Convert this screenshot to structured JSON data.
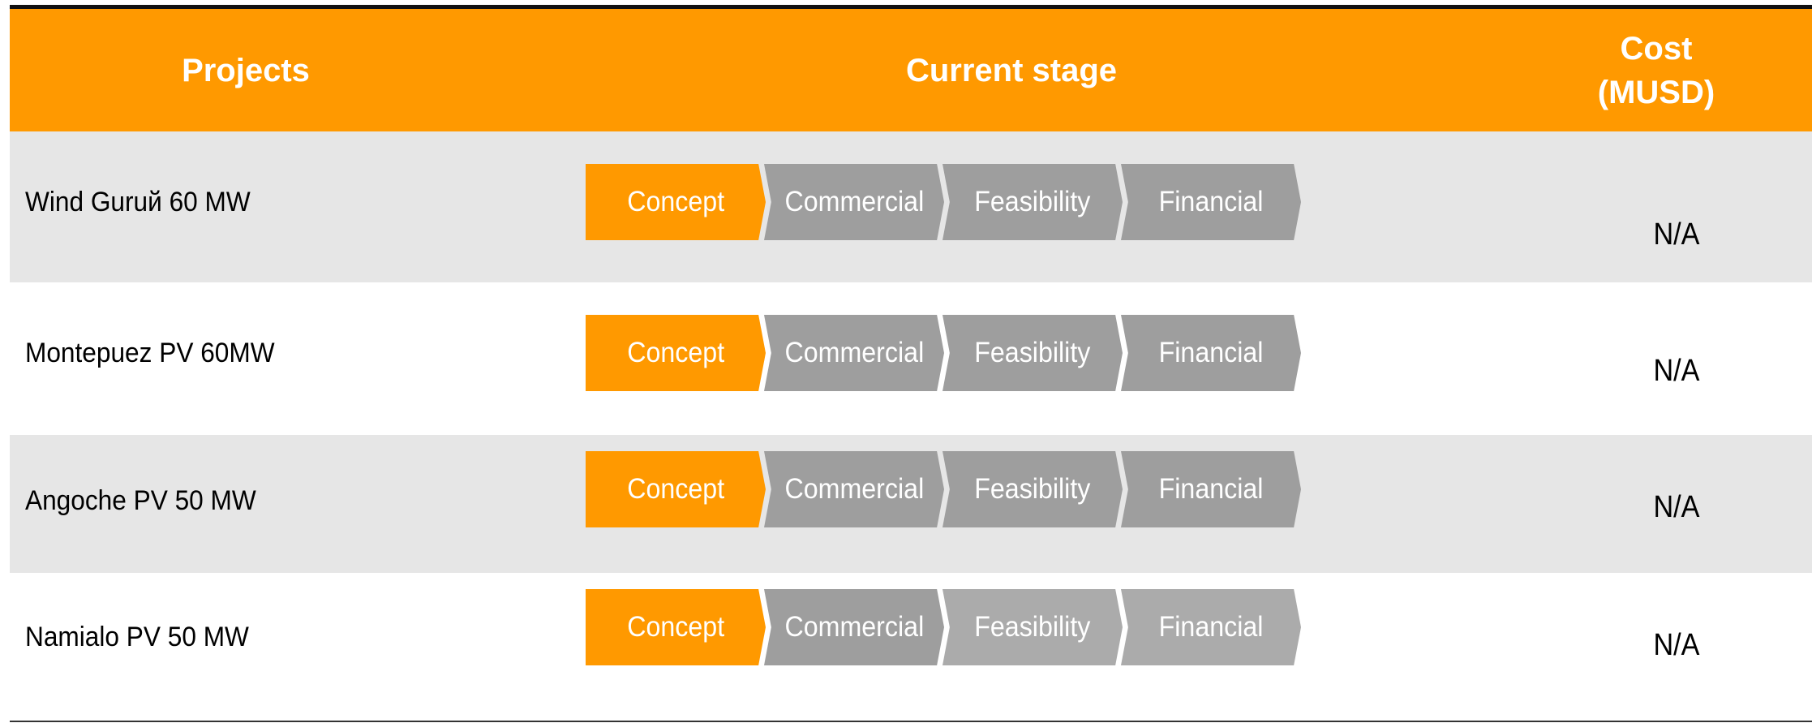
{
  "header": {
    "projects": "Projects",
    "current_stage": "Current stage",
    "cost": "Cost\n(MUSD)"
  },
  "stage_labels": [
    "Concept",
    "Commercial",
    "Feasibility",
    "Financial"
  ],
  "rows": [
    {
      "project": "Wind Guruй 60 MW",
      "cost": "N/A",
      "current_stage": "Concept"
    },
    {
      "project": "Montepuez PV 60MW",
      "cost": "N/A",
      "current_stage": "Concept"
    },
    {
      "project": "Angoche PV 50 MW",
      "cost": "N/A",
      "current_stage": "Concept"
    },
    {
      "project": "Namialo PV 50 MW",
      "cost": "N/A",
      "current_stage": "Concept"
    }
  ],
  "colors": {
    "accent": "#FF9900",
    "stage_inactive": "#9E9E9E",
    "stage_inactive_light": "#ABABAB",
    "row_shaded": "#E6E6E6"
  }
}
